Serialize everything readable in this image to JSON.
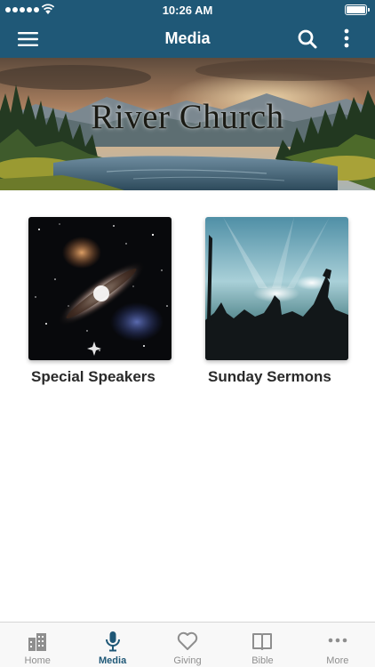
{
  "status_bar": {
    "time": "10:26 AM"
  },
  "nav": {
    "title": "Media"
  },
  "banner": {
    "title": "River Church"
  },
  "media_items": [
    {
      "label": "Special Speakers"
    },
    {
      "label": "Sunday Sermons"
    }
  ],
  "tabs": [
    {
      "label": "Home",
      "icon": "home-icon"
    },
    {
      "label": "Media",
      "icon": "microphone-icon",
      "active": true
    },
    {
      "label": "Giving",
      "icon": "heart-icon"
    },
    {
      "label": "Bible",
      "icon": "book-icon"
    },
    {
      "label": "More",
      "icon": "more-dots-icon"
    }
  ],
  "colors": {
    "header": "#1f5877",
    "active_tab": "#1f5877",
    "inactive_tab": "#8e8e8e"
  }
}
